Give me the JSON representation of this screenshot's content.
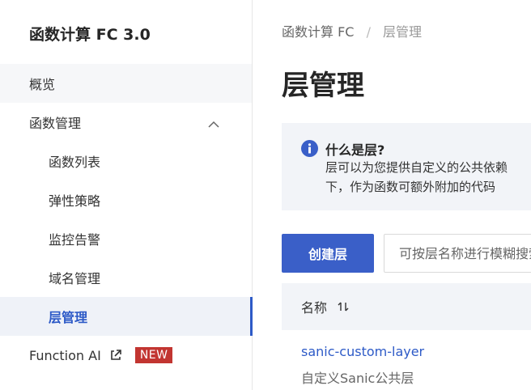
{
  "sidebar": {
    "title": "函数计算 FC 3.0",
    "items": {
      "overview": "概览",
      "function_mgmt": "函数管理",
      "function_list": "函数列表",
      "elastic_policy": "弹性策略",
      "monitoring_alerts": "监控告警",
      "domain_mgmt": "域名管理",
      "layer_mgmt": "层管理",
      "function_ai": "Function AI",
      "function_ai_badge": "NEW"
    }
  },
  "breadcrumb": {
    "root": "函数计算 FC",
    "separator": "/",
    "current": "层管理"
  },
  "page": {
    "title": "层管理"
  },
  "info": {
    "title": "什么是层?",
    "line1": "层可以为您提供自定义的公共依赖",
    "line2": "下，作为函数可额外附加的代码"
  },
  "toolbar": {
    "create_label": "创建层",
    "search_placeholder": "可按层名称进行模糊搜索"
  },
  "table": {
    "columns": {
      "name": "名称"
    },
    "rows": [
      {
        "name": "sanic-custom-layer",
        "description": "自定义Sanic公共层"
      }
    ]
  },
  "colors": {
    "accent": "#2d5ac7",
    "badge": "#c23531",
    "info_bg": "#f2f4f8"
  },
  "icons": [
    "chevron-up-icon",
    "external-link-icon",
    "info-icon",
    "sort-icon"
  ]
}
